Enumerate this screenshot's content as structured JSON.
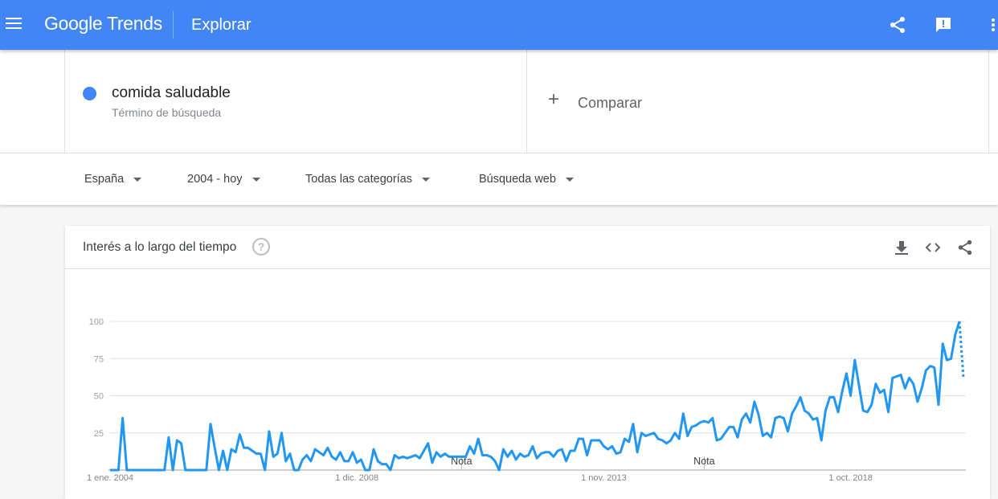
{
  "header": {
    "brand": "Google Trends",
    "page_title": "Explorar",
    "icons": [
      "menu-icon",
      "share-icon",
      "feedback-icon",
      "apps-icon"
    ]
  },
  "search": {
    "term": "comida saludable",
    "term_type": "Término de búsqueda",
    "compare_label": "Comparar",
    "term_color": "#4285f4"
  },
  "filters": {
    "region": "España",
    "period": "2004 - hoy",
    "category": "Todas las categorías",
    "search_type": "Búsqueda web"
  },
  "chart_card": {
    "title": "Interés a lo largo del tiempo",
    "icons": [
      "help-icon",
      "download-icon",
      "embed-icon",
      "share-icon"
    ]
  },
  "chart_data": {
    "type": "line",
    "series": [
      {
        "name": "comida saludable",
        "color": "#2196f3"
      }
    ],
    "x_tick_labels": [
      "1 ene. 2004",
      "1 dic. 2008",
      "1 nov. 2013",
      "1 oct. 2018"
    ],
    "y_tick_labels": [
      "100",
      "75",
      "50",
      "25"
    ],
    "ylim": [
      0,
      100
    ],
    "notes": [
      "Nota",
      "Nota"
    ],
    "values": [
      0,
      0,
      0,
      35,
      0,
      0,
      0,
      0,
      0,
      0,
      0,
      0,
      0,
      0,
      22,
      0,
      20,
      18,
      0,
      0,
      0,
      0,
      0,
      0,
      31,
      15,
      0,
      13,
      0,
      14,
      12,
      24,
      15,
      15,
      13,
      11,
      11,
      0,
      26,
      9,
      11,
      25,
      6,
      11,
      0,
      0,
      7,
      10,
      6,
      14,
      12,
      10,
      15,
      9,
      7,
      12,
      6,
      6,
      12,
      5,
      7,
      0,
      0,
      14,
      6,
      4,
      4,
      0,
      10,
      8,
      9,
      8,
      9,
      10,
      8,
      13,
      18,
      5,
      12,
      9,
      11,
      9,
      9,
      9,
      9,
      9,
      16,
      11,
      21,
      10,
      10,
      9,
      6,
      0,
      14,
      9,
      13,
      7,
      11,
      9,
      10,
      16,
      8,
      11,
      12,
      12,
      9,
      13,
      14,
      6,
      13,
      13,
      21,
      21,
      10,
      20,
      20,
      20,
      16,
      14,
      16,
      11,
      12,
      21,
      19,
      31,
      12,
      25,
      23,
      24,
      25,
      21,
      20,
      18,
      20,
      25,
      21,
      38,
      23,
      29,
      30,
      32,
      33,
      32,
      35,
      20,
      21,
      25,
      29,
      29,
      22,
      34,
      38,
      32,
      46,
      37,
      23,
      25,
      22,
      35,
      36,
      35,
      26,
      38,
      43,
      49,
      40,
      38,
      34,
      35,
      20,
      40,
      49,
      49,
      39,
      53,
      65,
      50,
      74,
      57,
      40,
      39,
      44,
      58,
      52,
      54,
      39,
      62,
      63,
      64,
      55,
      62,
      58,
      46,
      55,
      67,
      70,
      69,
      44,
      85,
      74,
      75,
      91,
      100
    ],
    "partial_tail": [
      100,
      62
    ]
  }
}
